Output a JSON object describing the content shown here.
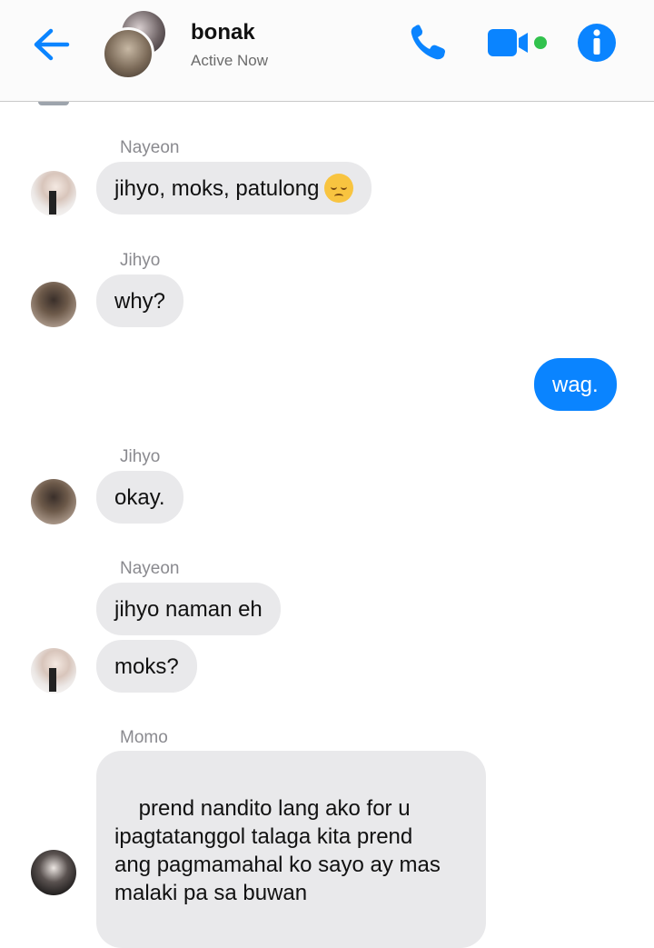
{
  "header": {
    "title": "bonak",
    "status": "Active Now",
    "accent": "#0a84ff",
    "active_dot": "#31c24d",
    "icons": [
      "back-arrow-icon",
      "phone-icon",
      "video-camera-icon",
      "info-icon"
    ]
  },
  "messages": [
    {
      "sender": "Nayeon",
      "text": "jihyo, moks, patulong",
      "emoji": "pensive-face"
    },
    {
      "sender": "Jihyo",
      "text": "why?"
    },
    {
      "sender": "me",
      "text": "wag."
    },
    {
      "sender": "Jihyo",
      "text": "okay."
    },
    {
      "sender": "Nayeon",
      "text": "jihyo naman eh"
    },
    {
      "sender": "Nayeon",
      "text": "moks?"
    },
    {
      "sender": "Momo",
      "text": "prend nandito lang ako for u\nipagtatanggol talaga kita prend\nang pagmamahal ko sayo ay mas\nmalaki pa sa buwan"
    }
  ]
}
